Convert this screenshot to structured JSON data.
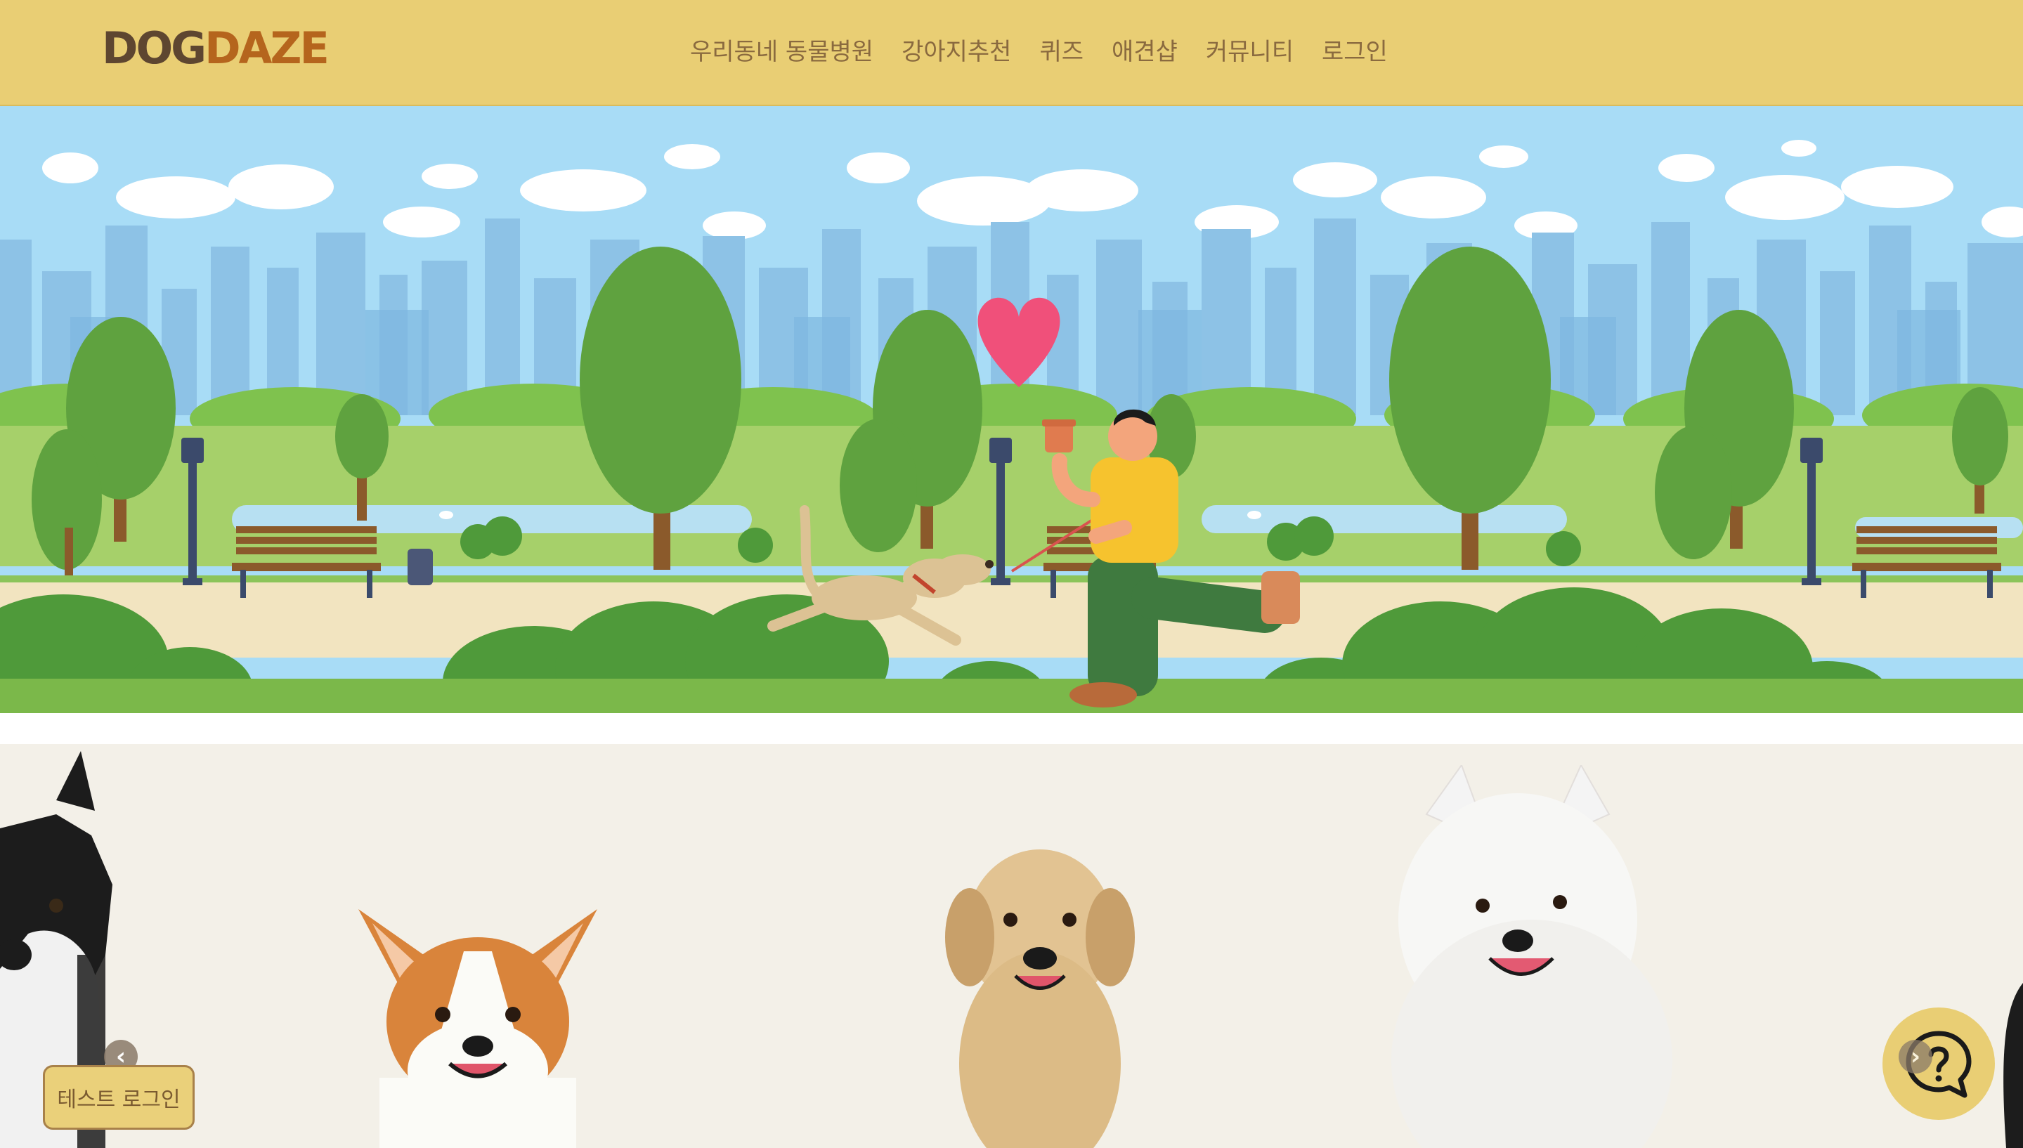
{
  "header": {
    "logo": {
      "part1": "DOG",
      "part2": "DAZE"
    },
    "nav": [
      {
        "label": "우리동네 동물병원"
      },
      {
        "label": "강아지추천"
      },
      {
        "label": "퀴즈"
      },
      {
        "label": "애견샵"
      },
      {
        "label": "커뮤니티"
      },
      {
        "label": "로그인"
      }
    ]
  },
  "floating": {
    "test_login_label": "테스트 로그인"
  },
  "colors": {
    "header_bg": "#e9ce74",
    "sky": "#a8dcf6",
    "grass": "#a6d06a",
    "gallery_bg": "#f3f0e8",
    "heart": "#f0507a"
  }
}
